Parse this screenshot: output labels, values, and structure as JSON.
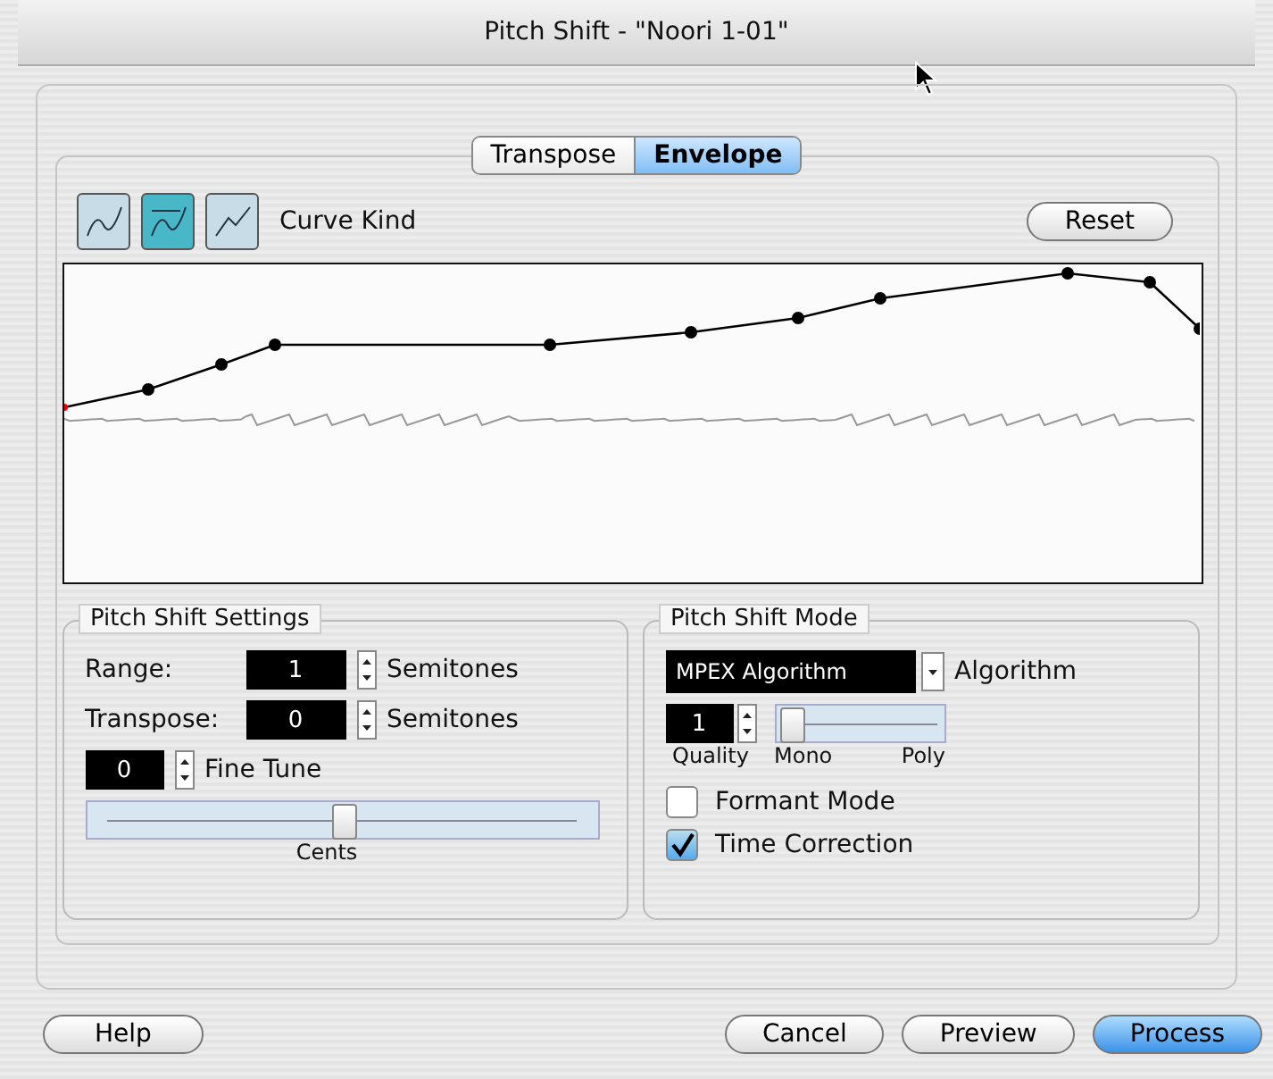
{
  "window": {
    "title": "Pitch Shift - \"Noori 1-01\""
  },
  "tabs": [
    {
      "label": "Transpose",
      "selected": false
    },
    {
      "label": "Envelope",
      "selected": true
    }
  ],
  "curve_kinds": [
    {
      "selected": false
    },
    {
      "selected": true
    },
    {
      "selected": false
    }
  ],
  "curve_kind_label": "Curve Kind",
  "reset_button": "Reset",
  "settings": {
    "title": "Pitch Shift Settings",
    "range": {
      "label": "Range:",
      "value": "1",
      "unit": "Semitones"
    },
    "transpose": {
      "label": "Transpose:",
      "value": "0",
      "unit": "Semitones"
    },
    "fine_tune": {
      "value": "0",
      "label": "Fine Tune"
    },
    "cents": {
      "level": 0.5,
      "label": "Cents"
    }
  },
  "mode": {
    "title": "Pitch Shift Mode",
    "algorithm": {
      "value": "MPEX Algorithm",
      "label": "Algorithm"
    },
    "quality": {
      "value": "1",
      "label": "Quality"
    },
    "voices": {
      "level": 0.03,
      "min_label": "Mono",
      "max_label": "Poly"
    },
    "options": [
      {
        "label": "Formant Mode",
        "checked": false
      },
      {
        "label": "Time Correction",
        "checked": true
      }
    ]
  },
  "buttons": [
    {
      "label": "Help",
      "kind": "help",
      "default": false
    },
    {
      "label": "Cancel",
      "kind": "action",
      "default": false
    },
    {
      "label": "Preview",
      "kind": "action",
      "default": false
    },
    {
      "label": "Process",
      "kind": "action",
      "default": true
    }
  ]
}
